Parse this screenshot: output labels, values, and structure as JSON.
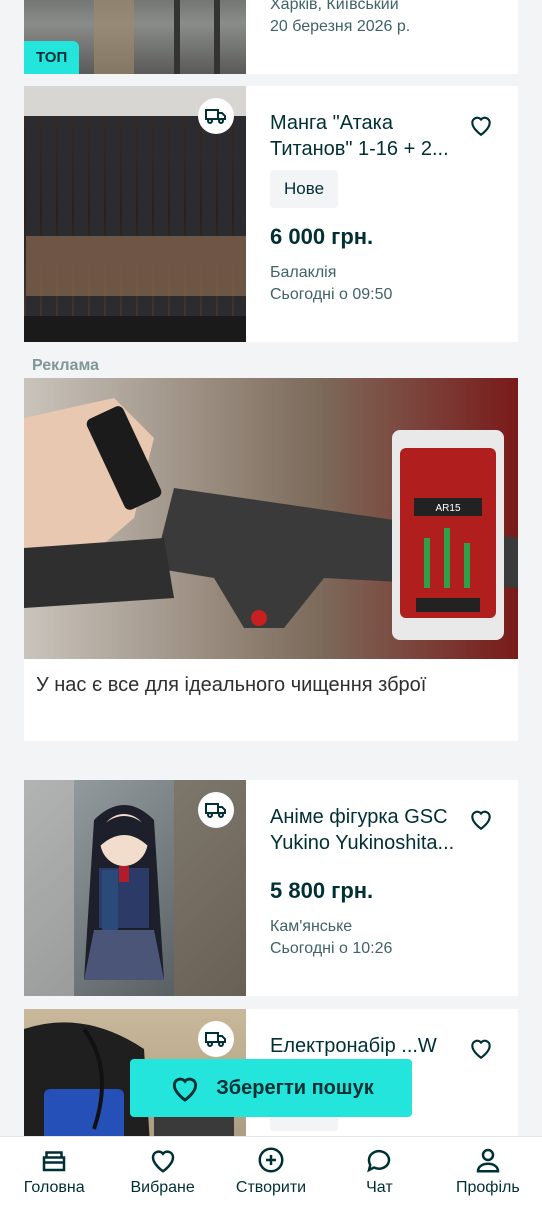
{
  "listings": [
    {
      "title": "",
      "location": "Харків, Київський",
      "date": "20 березня 2026 р.",
      "badge": "ТОП"
    },
    {
      "title": "Манга \"Атака Титанов\" 1-16 + 2...",
      "condition": "Нове",
      "price": "6 000 грн.",
      "location": "Балаклія",
      "date": "Сьогодні о 09:50"
    },
    {
      "title": "Аніме фігурка GSC Yukino Yukinoshita...",
      "price": "5 800 грн.",
      "location": "Кам'янське",
      "date": "Сьогодні о 10:26"
    },
    {
      "title": "Електронабір ...W н...",
      "condition": "Нове"
    }
  ],
  "ad": {
    "label": "Реклама",
    "text": "У нас є все для ідеального чищення зброї"
  },
  "save_search": {
    "label": "Зберегти пошук"
  },
  "bottom_nav": [
    {
      "label": "Головна",
      "icon": "home-icon"
    },
    {
      "label": "Вибране",
      "icon": "heart-icon"
    },
    {
      "label": "Створити",
      "icon": "plus-circle-icon"
    },
    {
      "label": "Чат",
      "icon": "chat-icon"
    },
    {
      "label": "Профіль",
      "icon": "user-icon"
    }
  ],
  "colors": {
    "accent": "#23e5db",
    "text": "#002f34",
    "muted": "#406367"
  }
}
